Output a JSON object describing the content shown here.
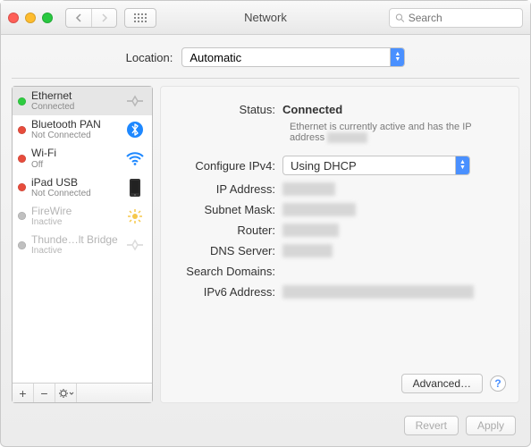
{
  "toolbar": {
    "title": "Network",
    "search_placeholder": "Search"
  },
  "location": {
    "label": "Location:",
    "value": "Automatic"
  },
  "sidebar": {
    "items": [
      {
        "name": "Ethernet",
        "sub": "Connected",
        "status": "green",
        "icon": "ethernet",
        "selected": true,
        "dim": false
      },
      {
        "name": "Bluetooth PAN",
        "sub": "Not Connected",
        "status": "red",
        "icon": "bluetooth",
        "selected": false,
        "dim": false
      },
      {
        "name": "Wi-Fi",
        "sub": "Off",
        "status": "red",
        "icon": "wifi",
        "selected": false,
        "dim": false
      },
      {
        "name": "iPad USB",
        "sub": "Not Connected",
        "status": "red",
        "icon": "ipad",
        "selected": false,
        "dim": false
      },
      {
        "name": "FireWire",
        "sub": "Inactive",
        "status": "gray",
        "icon": "firewire",
        "selected": false,
        "dim": true
      },
      {
        "name": "Thunde…lt Bridge",
        "sub": "Inactive",
        "status": "gray",
        "icon": "thunderbolt",
        "selected": false,
        "dim": true
      }
    ]
  },
  "detail": {
    "status_label": "Status:",
    "status_value": "Connected",
    "status_desc_prefix": "Ethernet is currently active and has the IP address ",
    "status_desc_blur": "xxx xxx x",
    "configure_label": "Configure IPv4:",
    "configure_value": "Using DHCP",
    "fields": [
      {
        "label": "IP Address:",
        "blur": "xxx xxx xx"
      },
      {
        "label": "Subnet Mask:",
        "blur": "xxx xxx xxx xx"
      },
      {
        "label": "Router:",
        "blur": "xxx xxx x x"
      },
      {
        "label": "DNS Server:",
        "blur": "x x xxx xx"
      },
      {
        "label": "Search Domains:",
        "blur": ""
      },
      {
        "label": "IPv6 Address:",
        "blur": "xxxx xxxx xxxx x xxxx xxxx xxxx xxxx"
      }
    ],
    "advanced_label": "Advanced…"
  },
  "footer": {
    "revert": "Revert",
    "apply": "Apply"
  }
}
